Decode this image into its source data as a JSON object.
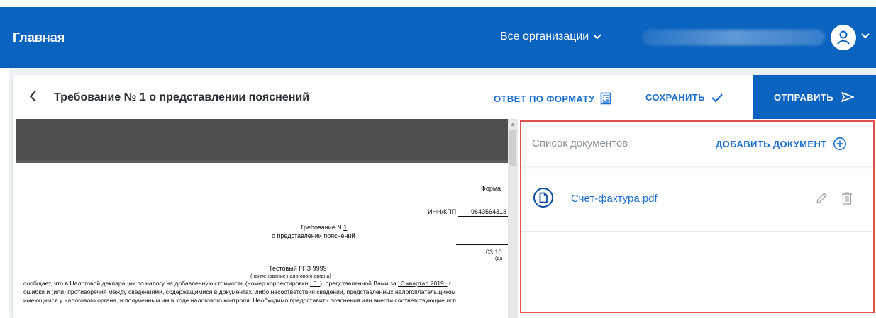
{
  "header": {
    "app_title": "Главная",
    "org_select_label": "Все организации"
  },
  "document": {
    "title": "Требование № 1 о представлении пояснений"
  },
  "actions": {
    "answer_format": "ОТВЕТ ПО ФОРМАТУ",
    "save": "СОХРАНИТЬ",
    "send": "ОТПРАВИТЬ"
  },
  "preview": {
    "form_label": "Форма",
    "inn_label": "ИНН/КПП",
    "inn_value": "9643564313",
    "req_title": "Требование N",
    "req_number": "1",
    "req_subtitle": "о представлении пояснений",
    "date_value": "03.10.",
    "date_hint": "(да",
    "org_name": "Тестовый ГПЗ 9999",
    "org_hint": "(наименование налогового органа)",
    "line1_a": "сообщает, что в Налоговой декларации по налогу на добавленную стоимость (номер корректировки",
    "line1_b": "0",
    "line1_c": "), представленной Вами за",
    "line1_d": "3 квартал 2019",
    "line1_e": "г",
    "line2": "ошибки и (или) противоречия между сведениями, содержащимися в документах, либо несоответствия сведений, представленных налогоплательщиком",
    "line3": "имеющимся у налогового органа, и полученным им в ходе налогового контроля. Необходимо предоставить пояснения или внести соответствующие исп"
  },
  "documents_panel": {
    "title": "Список документов",
    "add_label": "ДОБАВИТЬ ДОКУМЕНТ",
    "files": [
      {
        "name": "Счет-фактура.pdf"
      }
    ]
  },
  "colors": {
    "brand": "#0b63c0",
    "link": "#1d6fd0",
    "highlight_border": "#e05252"
  }
}
